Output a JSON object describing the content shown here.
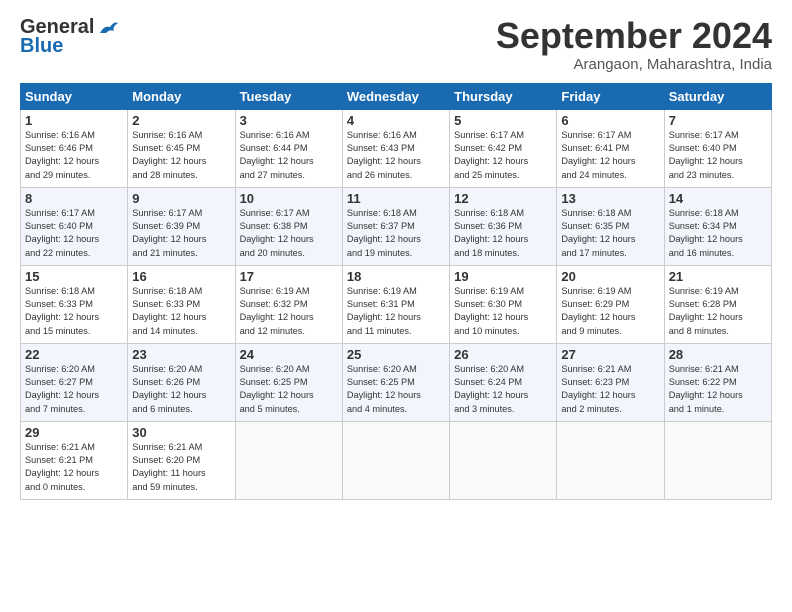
{
  "header": {
    "logo_general": "General",
    "logo_blue": "Blue",
    "title": "September 2024",
    "location": "Arangaon, Maharashtra, India"
  },
  "days_of_week": [
    "Sunday",
    "Monday",
    "Tuesday",
    "Wednesday",
    "Thursday",
    "Friday",
    "Saturday"
  ],
  "weeks": [
    [
      {
        "day": "1",
        "info": "Sunrise: 6:16 AM\nSunset: 6:46 PM\nDaylight: 12 hours\nand 29 minutes."
      },
      {
        "day": "2",
        "info": "Sunrise: 6:16 AM\nSunset: 6:45 PM\nDaylight: 12 hours\nand 28 minutes."
      },
      {
        "day": "3",
        "info": "Sunrise: 6:16 AM\nSunset: 6:44 PM\nDaylight: 12 hours\nand 27 minutes."
      },
      {
        "day": "4",
        "info": "Sunrise: 6:16 AM\nSunset: 6:43 PM\nDaylight: 12 hours\nand 26 minutes."
      },
      {
        "day": "5",
        "info": "Sunrise: 6:17 AM\nSunset: 6:42 PM\nDaylight: 12 hours\nand 25 minutes."
      },
      {
        "day": "6",
        "info": "Sunrise: 6:17 AM\nSunset: 6:41 PM\nDaylight: 12 hours\nand 24 minutes."
      },
      {
        "day": "7",
        "info": "Sunrise: 6:17 AM\nSunset: 6:40 PM\nDaylight: 12 hours\nand 23 minutes."
      }
    ],
    [
      {
        "day": "8",
        "info": "Sunrise: 6:17 AM\nSunset: 6:40 PM\nDaylight: 12 hours\nand 22 minutes."
      },
      {
        "day": "9",
        "info": "Sunrise: 6:17 AM\nSunset: 6:39 PM\nDaylight: 12 hours\nand 21 minutes."
      },
      {
        "day": "10",
        "info": "Sunrise: 6:17 AM\nSunset: 6:38 PM\nDaylight: 12 hours\nand 20 minutes."
      },
      {
        "day": "11",
        "info": "Sunrise: 6:18 AM\nSunset: 6:37 PM\nDaylight: 12 hours\nand 19 minutes."
      },
      {
        "day": "12",
        "info": "Sunrise: 6:18 AM\nSunset: 6:36 PM\nDaylight: 12 hours\nand 18 minutes."
      },
      {
        "day": "13",
        "info": "Sunrise: 6:18 AM\nSunset: 6:35 PM\nDaylight: 12 hours\nand 17 minutes."
      },
      {
        "day": "14",
        "info": "Sunrise: 6:18 AM\nSunset: 6:34 PM\nDaylight: 12 hours\nand 16 minutes."
      }
    ],
    [
      {
        "day": "15",
        "info": "Sunrise: 6:18 AM\nSunset: 6:33 PM\nDaylight: 12 hours\nand 15 minutes."
      },
      {
        "day": "16",
        "info": "Sunrise: 6:18 AM\nSunset: 6:33 PM\nDaylight: 12 hours\nand 14 minutes."
      },
      {
        "day": "17",
        "info": "Sunrise: 6:19 AM\nSunset: 6:32 PM\nDaylight: 12 hours\nand 12 minutes."
      },
      {
        "day": "18",
        "info": "Sunrise: 6:19 AM\nSunset: 6:31 PM\nDaylight: 12 hours\nand 11 minutes."
      },
      {
        "day": "19",
        "info": "Sunrise: 6:19 AM\nSunset: 6:30 PM\nDaylight: 12 hours\nand 10 minutes."
      },
      {
        "day": "20",
        "info": "Sunrise: 6:19 AM\nSunset: 6:29 PM\nDaylight: 12 hours\nand 9 minutes."
      },
      {
        "day": "21",
        "info": "Sunrise: 6:19 AM\nSunset: 6:28 PM\nDaylight: 12 hours\nand 8 minutes."
      }
    ],
    [
      {
        "day": "22",
        "info": "Sunrise: 6:20 AM\nSunset: 6:27 PM\nDaylight: 12 hours\nand 7 minutes."
      },
      {
        "day": "23",
        "info": "Sunrise: 6:20 AM\nSunset: 6:26 PM\nDaylight: 12 hours\nand 6 minutes."
      },
      {
        "day": "24",
        "info": "Sunrise: 6:20 AM\nSunset: 6:25 PM\nDaylight: 12 hours\nand 5 minutes."
      },
      {
        "day": "25",
        "info": "Sunrise: 6:20 AM\nSunset: 6:25 PM\nDaylight: 12 hours\nand 4 minutes."
      },
      {
        "day": "26",
        "info": "Sunrise: 6:20 AM\nSunset: 6:24 PM\nDaylight: 12 hours\nand 3 minutes."
      },
      {
        "day": "27",
        "info": "Sunrise: 6:21 AM\nSunset: 6:23 PM\nDaylight: 12 hours\nand 2 minutes."
      },
      {
        "day": "28",
        "info": "Sunrise: 6:21 AM\nSunset: 6:22 PM\nDaylight: 12 hours\nand 1 minute."
      }
    ],
    [
      {
        "day": "29",
        "info": "Sunrise: 6:21 AM\nSunset: 6:21 PM\nDaylight: 12 hours\nand 0 minutes."
      },
      {
        "day": "30",
        "info": "Sunrise: 6:21 AM\nSunset: 6:20 PM\nDaylight: 11 hours\nand 59 minutes."
      },
      {
        "day": "",
        "info": ""
      },
      {
        "day": "",
        "info": ""
      },
      {
        "day": "",
        "info": ""
      },
      {
        "day": "",
        "info": ""
      },
      {
        "day": "",
        "info": ""
      }
    ]
  ]
}
